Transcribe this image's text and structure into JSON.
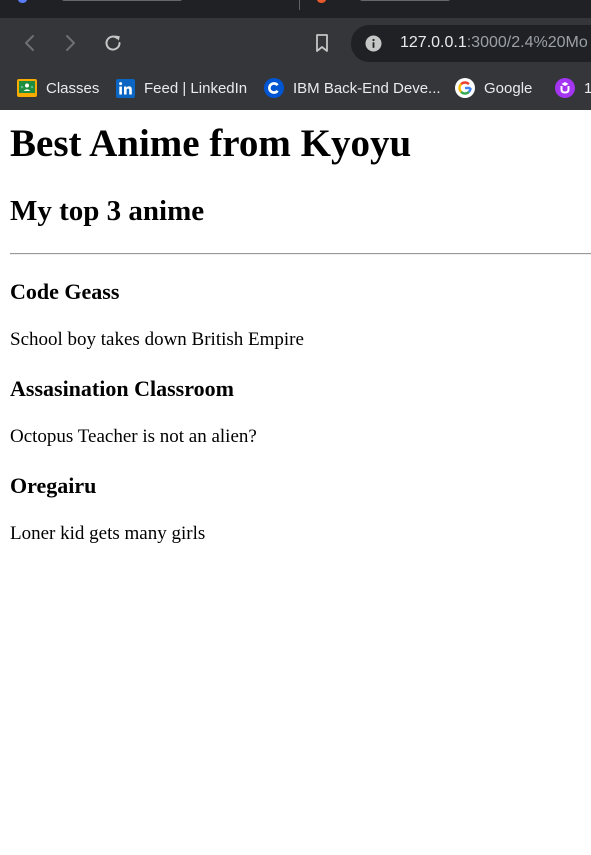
{
  "browser": {
    "address_bar": {
      "url_host": "127.0.0.1",
      "url_rest": ":3000/2.4%20Mo"
    },
    "bookmarks": [
      {
        "label": "Classes",
        "icon": "google-classroom-icon"
      },
      {
        "label": "Feed | LinkedIn",
        "icon": "linkedin-icon"
      },
      {
        "label": "IBM Back-End Deve...",
        "icon": "coursera-icon"
      },
      {
        "label": "Google",
        "icon": "google-icon"
      },
      {
        "label": "1",
        "icon": "udemy-icon"
      }
    ],
    "colors": {
      "chrome_bg": "#35363a",
      "tabstrip_bg": "#202124",
      "omnibox_bg": "#202124",
      "text_light": "#e8eaed",
      "text_dim": "#9aa0a6",
      "linkedin": "#0a66c2",
      "coursera": "#0056d2",
      "udemy": "#a435f0"
    }
  },
  "page": {
    "title": "Best Anime from Kyoyu",
    "subtitle": "My top 3 anime",
    "anime": [
      {
        "title": "Code Geass",
        "description": "School boy takes down British Empire"
      },
      {
        "title": "Assasination Classroom",
        "description": "Octopus Teacher is not an alien?"
      },
      {
        "title": "Oregairu",
        "description": "Loner kid gets many girls"
      }
    ]
  }
}
